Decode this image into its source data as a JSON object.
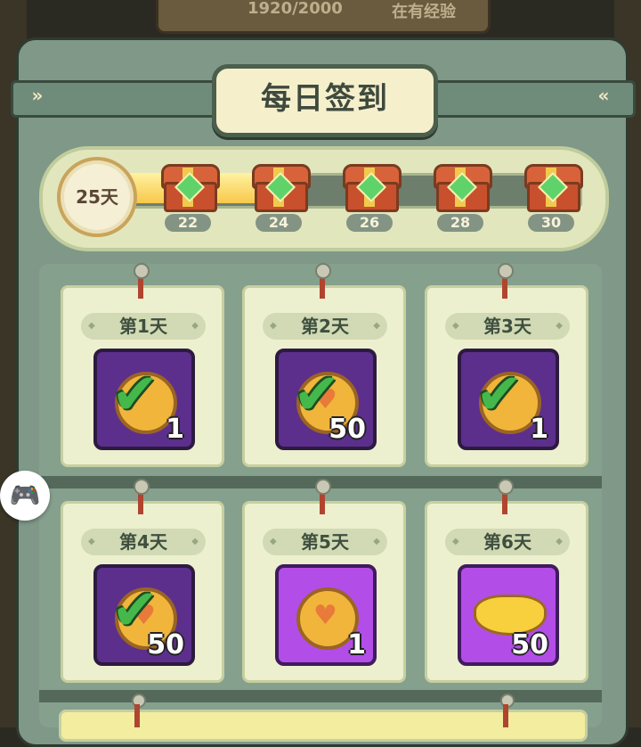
{
  "header": {
    "title": "每日签到",
    "top_counter": "1920/2000",
    "top_label": "在有经验"
  },
  "progress": {
    "current_days": "25天",
    "fill_fraction": 0.37,
    "milestones": [
      "22",
      "24",
      "26",
      "28",
      "30"
    ]
  },
  "days": [
    {
      "label": "第1天",
      "qty": "1",
      "reward": "coin",
      "claimed": true
    },
    {
      "label": "第2天",
      "qty": "50",
      "reward": "heart-coin",
      "claimed": true
    },
    {
      "label": "第3天",
      "qty": "1",
      "reward": "coin",
      "claimed": true
    },
    {
      "label": "第4天",
      "qty": "50",
      "reward": "heart-coin",
      "claimed": true
    },
    {
      "label": "第5天",
      "qty": "1",
      "reward": "coin",
      "claimed": false
    },
    {
      "label": "第6天",
      "qty": "50",
      "reward": "gold-ingot",
      "claimed": false
    }
  ],
  "colors": {
    "panel_green": "#7f9888",
    "claimed_purple": "#5c2f8c",
    "available_purple": "#b34de8",
    "check_green": "#45b84c"
  }
}
